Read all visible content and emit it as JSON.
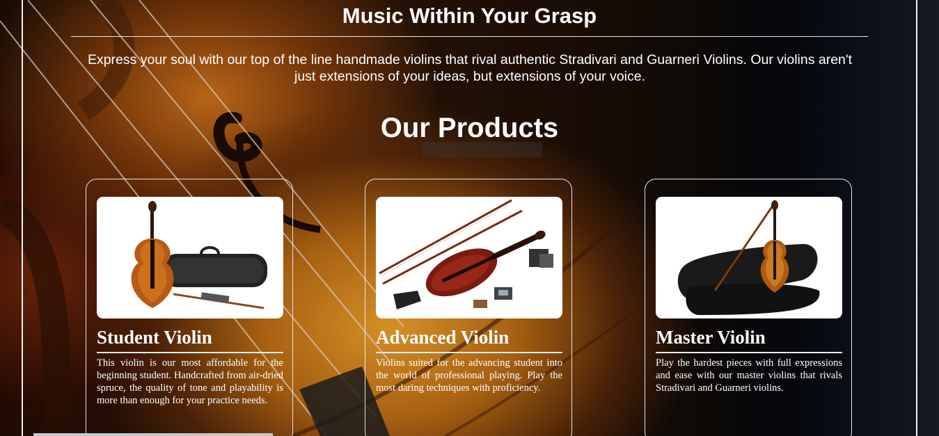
{
  "header": {
    "title": "Music Within Your Grasp",
    "intro": "Express your soul with our top of the line handmade violins that rival authentic Stradivari and Guarneri Violins. Our violins aren't just extensions of your ideas, but extensions of your voice."
  },
  "products": {
    "section_title": "Our Products",
    "items": [
      {
        "name": "Student Violin",
        "description": "This violin is our most affordable for the beginning student. Handcrafted from air-dried spruce, the quality of tone and playability is more than enough for your practice needs.",
        "image_icon": "violin-with-case-image"
      },
      {
        "name": "Advanced Violin",
        "description": "Violins suited for the advancing student into the world of professional playing. Play the most daring techniques with proficiency.",
        "image_icon": "violin-with-accessories-image"
      },
      {
        "name": "Master Violin",
        "description": "Play the hardest pieces with full expressions and ease with our master violins that rivals Stradivari and Guarneri violins.",
        "image_icon": "violin-in-open-case-image"
      }
    ]
  },
  "colors": {
    "text": "#ffffff",
    "background": "#0a0a0a",
    "violin_wood": "#c46a16",
    "card_border": "#e6e6e6"
  }
}
